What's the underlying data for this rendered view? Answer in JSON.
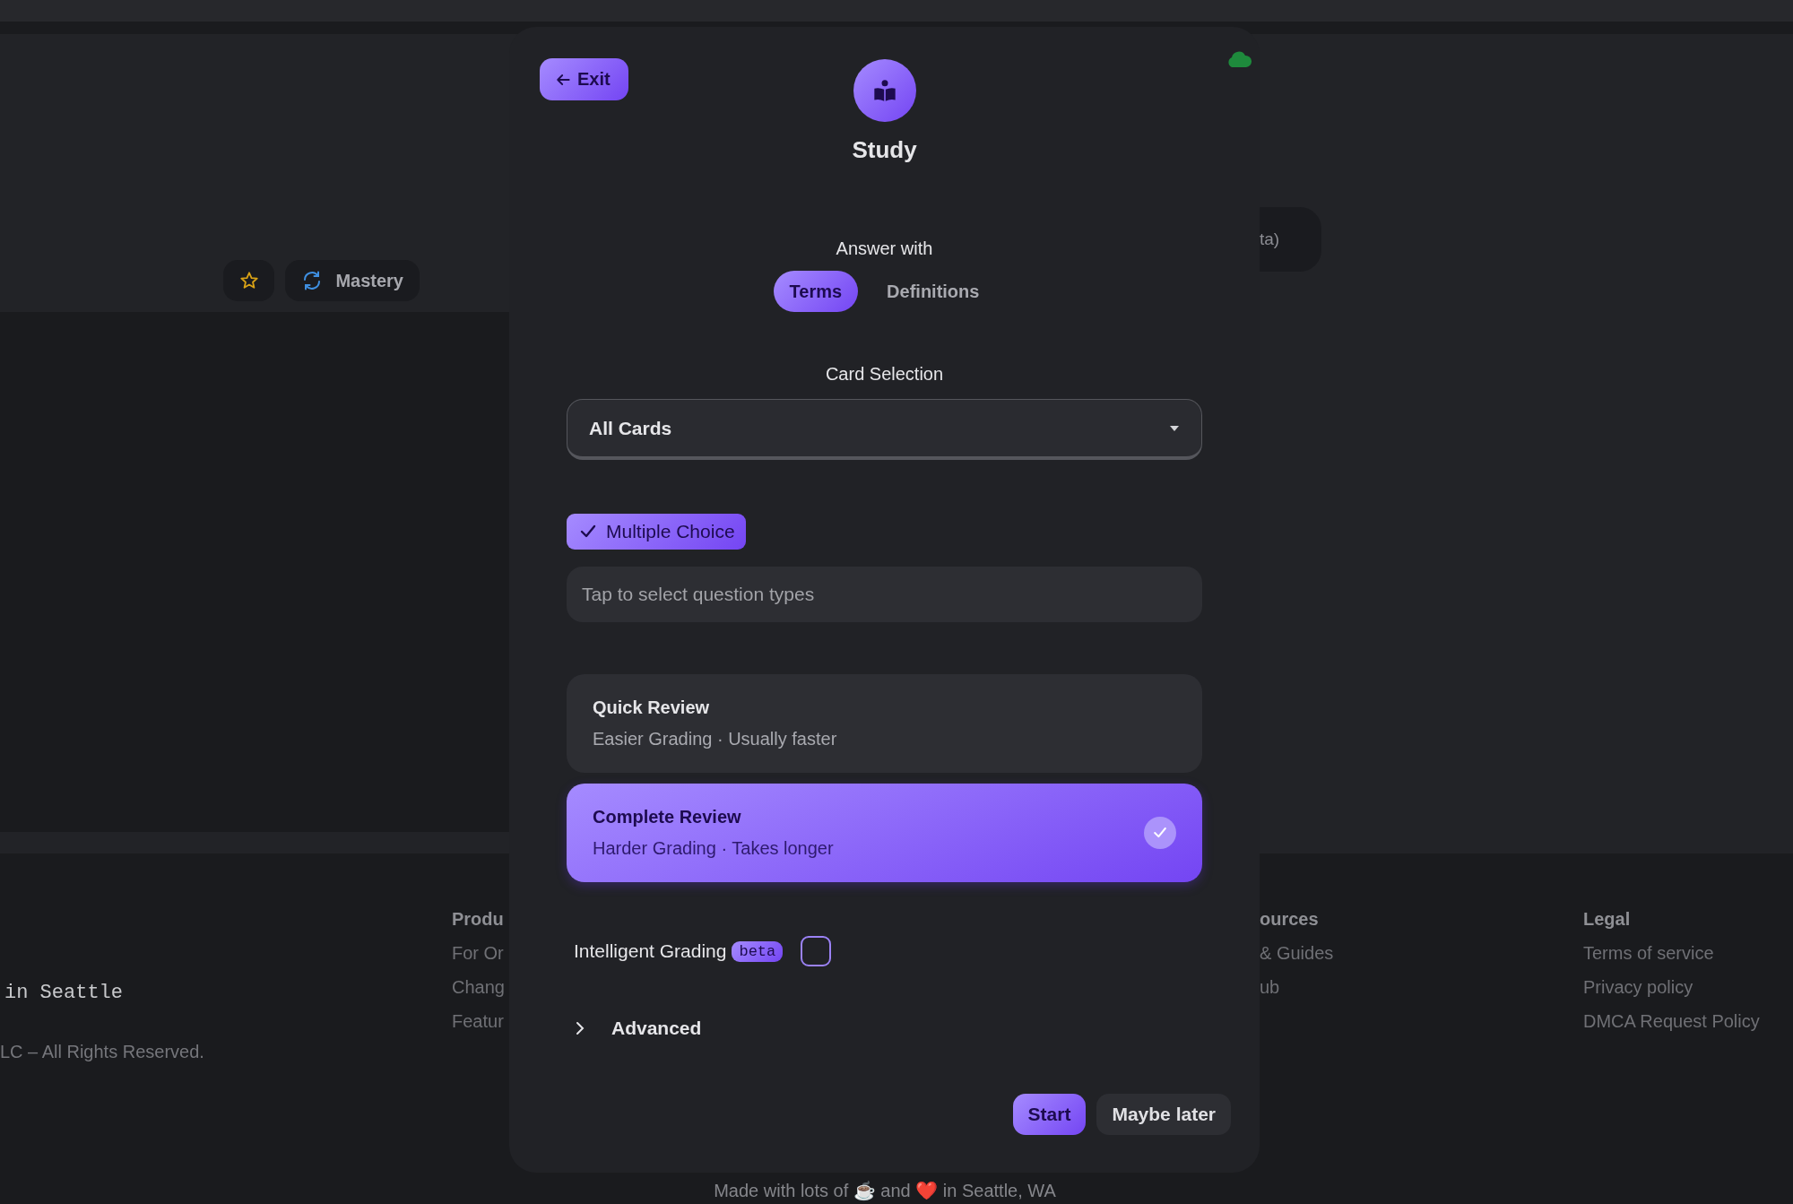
{
  "background": {
    "mode_button": {
      "label": "Mastery"
    },
    "side_pill": {
      "label": "ta)"
    }
  },
  "footer": {
    "tagline": "in Seattle",
    "copyright": "LC – All Rights Reserved.",
    "columns": [
      {
        "heading": "Produ",
        "links": [
          "For Or",
          "Chang",
          "Featur"
        ]
      },
      {
        "heading": "ources",
        "links": [
          "& Guides",
          "ub"
        ]
      },
      {
        "heading": "Legal",
        "links": [
          "Terms of service",
          "Privacy policy",
          "DMCA Request Policy"
        ]
      }
    ],
    "credit": "Made with lots of ☕ and ❤️ in Seattle, WA"
  },
  "modal": {
    "exit_button": "Exit",
    "title": "Study",
    "answer_with": {
      "label": "Answer with",
      "options": [
        {
          "label": "Terms",
          "selected": true
        },
        {
          "label": "Definitions",
          "selected": false
        }
      ]
    },
    "card_selection": {
      "label": "Card Selection",
      "value": "All Cards"
    },
    "question_types": [
      {
        "label": "Multiple Choice",
        "checked": true
      }
    ],
    "question_field": {
      "placeholder": "Tap to select question types"
    },
    "review_modes": [
      {
        "title": "Quick Review",
        "subtitle": "Easier Grading · Usually faster",
        "selected": false
      },
      {
        "title": "Complete Review",
        "subtitle": "Harder Grading · Takes longer",
        "selected": true
      }
    ],
    "intelligent_grading": {
      "label": "Intelligent Grading",
      "badge": "beta",
      "checked": false
    },
    "advanced": {
      "label": "Advanced",
      "expanded": false
    },
    "buttons": [
      {
        "label": "Start",
        "kind": "primary"
      },
      {
        "label": "Maybe later",
        "kind": "secondary"
      }
    ]
  }
}
